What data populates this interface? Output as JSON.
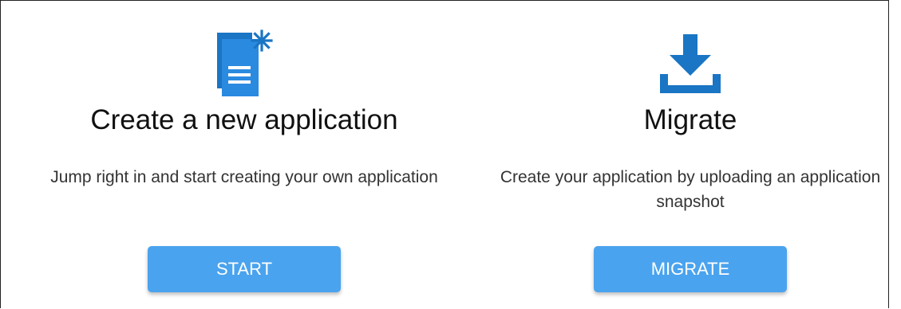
{
  "cards": [
    {
      "icon": "document-new-icon",
      "title": "Create a new application",
      "description": "Jump right in and start creating your own application",
      "button_label": "START"
    },
    {
      "icon": "download-icon",
      "title": "Migrate",
      "description": "Create your application by uploading an application snapshot",
      "button_label": "MIGRATE"
    }
  ],
  "colors": {
    "accent": "#4aa3ee",
    "icon": "#1a75c4",
    "border": "#222222"
  }
}
